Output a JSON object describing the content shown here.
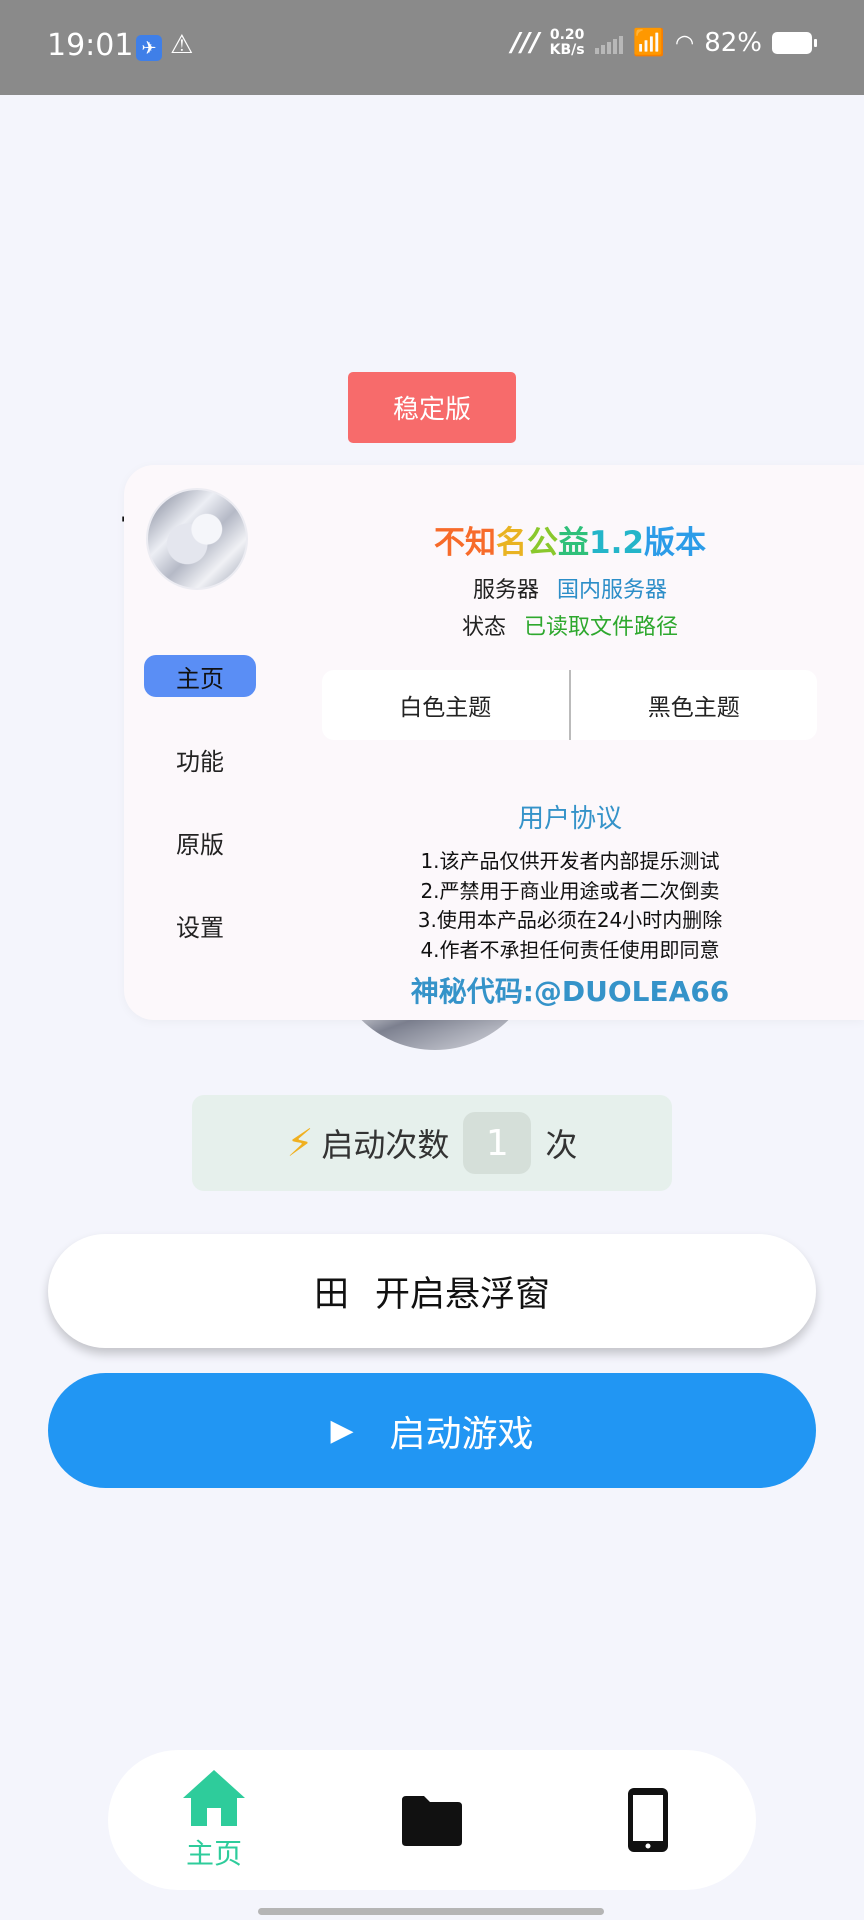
{
  "status_bar": {
    "time": "19:01",
    "net_speed_value": "0.20",
    "net_speed_unit": "KB/s",
    "battery": "82%"
  },
  "version_button": "稳定版",
  "panel": {
    "title_parts": [
      "不知",
      "名",
      "公",
      "益",
      "1.2",
      "版本"
    ],
    "server_label": "服务器",
    "server_value": "国内服务器",
    "status_label": "状态",
    "status_value": "已读取文件路径",
    "side_nav": [
      {
        "label": "主页",
        "active": true
      },
      {
        "label": "功能",
        "active": false
      },
      {
        "label": "原版",
        "active": false
      },
      {
        "label": "设置",
        "active": false
      }
    ],
    "theme_white": "白色主题",
    "theme_black": "黑色主题",
    "agreement_title": "用户协议",
    "agreement_items": [
      "1.该产品仅供开发者内部提乐测试",
      "2.严禁用于商业用途或者二次倒卖",
      "3.使用本产品必须在24小时内删除",
      "4.作者不承担任何责任使用即同意"
    ],
    "secret_code": "神秘代码:@DUOLEA66"
  },
  "launch_count": {
    "prefix": "启动次数",
    "count": "1",
    "suffix": "次"
  },
  "float_button": {
    "icon_glyph": "田",
    "label": "开启悬浮窗"
  },
  "start_button": {
    "label": "启动游戏"
  },
  "bottom_nav": {
    "home_label": "主页",
    "active_color": "#2ecc9b"
  },
  "colors": {
    "primary_blue": "#2196f3",
    "version_red": "#f76b6b",
    "nav_active_bg": "#5a8ef5"
  }
}
